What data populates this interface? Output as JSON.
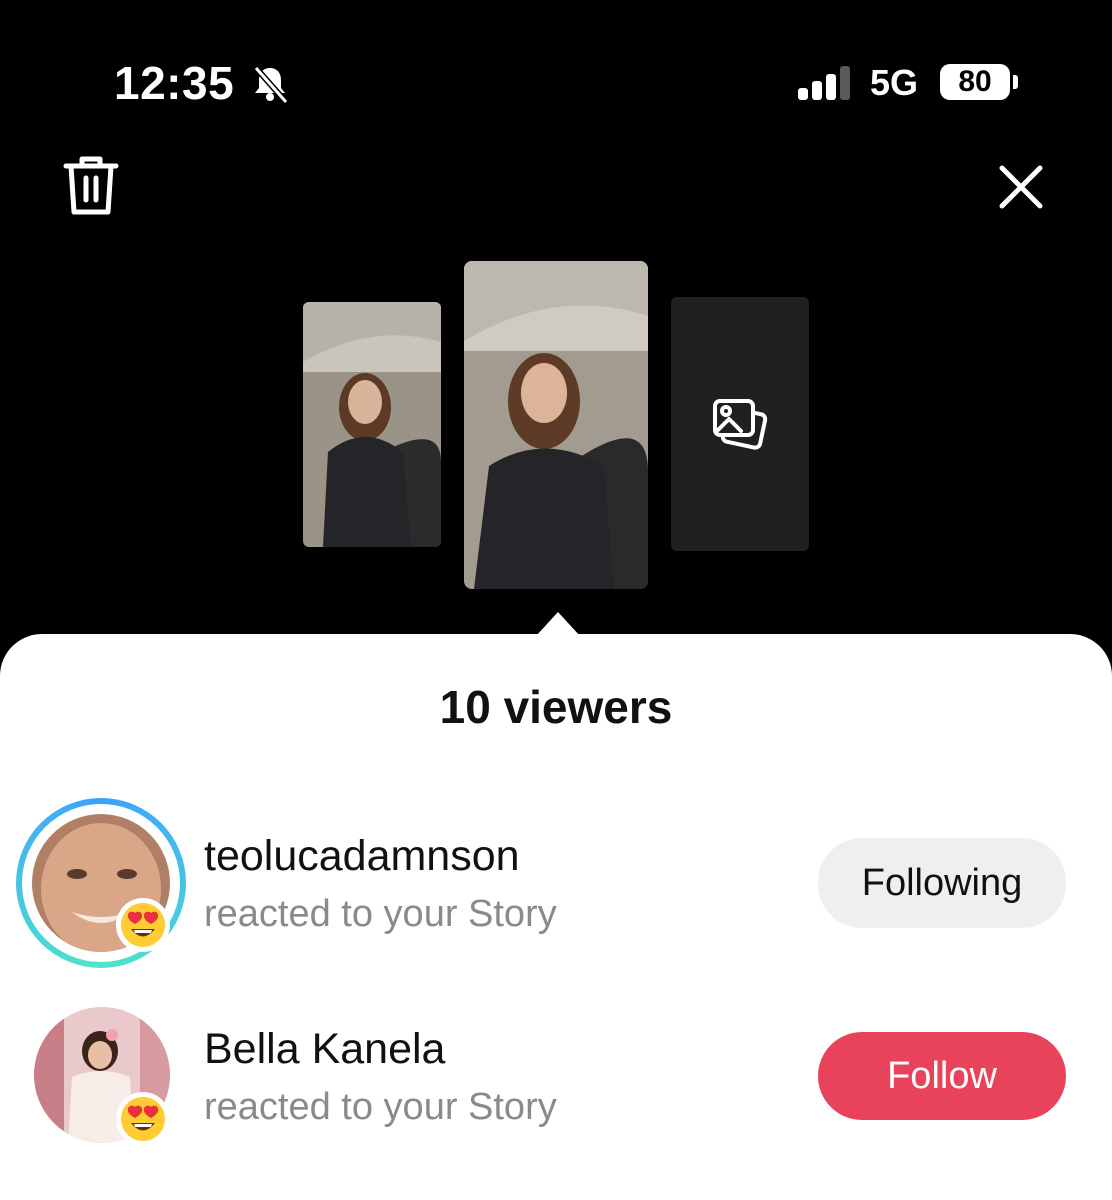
{
  "status_bar": {
    "time": "12:35",
    "network": "5G",
    "battery": "80",
    "icons": [
      "bell-slash-icon",
      "signal-icon"
    ]
  },
  "top_bar": {
    "icons": [
      "trash-icon",
      "close-icon"
    ]
  },
  "stories": {
    "add_icon": "gallery-icon"
  },
  "sheet": {
    "title": "10 viewers",
    "viewers": [
      {
        "name": "teolucadamnson",
        "subtitle": "reacted to your Story",
        "reaction": "heart-eyes-emoji",
        "button": "Following"
      },
      {
        "name": "Bella Kanela",
        "subtitle": "reacted to your Story",
        "reaction": "heart-eyes-emoji",
        "button": "Follow"
      }
    ]
  },
  "colors": {
    "follow_button": "#e9435c",
    "following_button": "#efefef",
    "ring_gradient": [
      "#3ea0ff",
      "#4ee6c8"
    ]
  }
}
